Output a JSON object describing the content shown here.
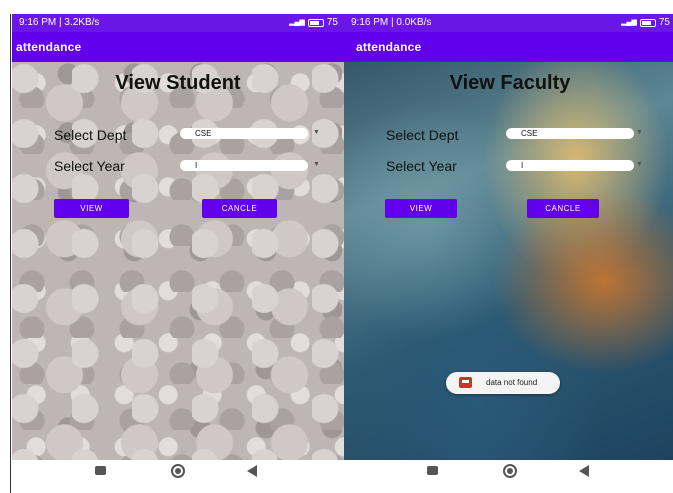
{
  "left": {
    "status": {
      "time": "9:16 PM | 3.2KB/s",
      "battery": "75"
    },
    "appbar_title": "attendance",
    "page_title": "View Student",
    "dept_label": "Select Dept",
    "dept_value": "CSE",
    "year_label": "Select Year",
    "year_value": "I",
    "view_button": "VIEW",
    "cancel_button": "CANCLE"
  },
  "right": {
    "status": {
      "time": "9:16 PM | 0.0KB/s",
      "battery": "75"
    },
    "appbar_title": "attendance",
    "page_title": "View Faculty",
    "dept_label": "Select Dept",
    "dept_value": "CSE",
    "year_label": "Select Year",
    "year_value": "I",
    "view_button": "VIEW",
    "cancel_button": "CANCLE",
    "toast": "data not found"
  },
  "icons": {
    "dropdown": "triangle-down-icon",
    "nav_recents": "square-icon",
    "nav_home": "circle-icon",
    "nav_back": "triangle-left-icon"
  },
  "colors": {
    "primary": "#6200ee",
    "statusbar": "#6a16e6"
  }
}
